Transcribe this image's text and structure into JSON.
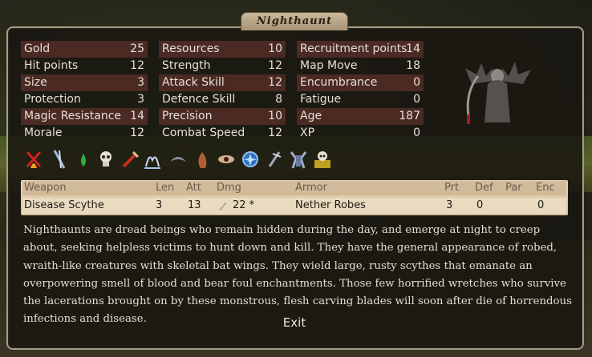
{
  "window": {
    "title": "Nighthaunt"
  },
  "stats": {
    "col1": [
      {
        "label": "Gold",
        "value": "25"
      },
      {
        "label": "Hit points",
        "value": "12"
      },
      {
        "label": "Size",
        "value": "3"
      },
      {
        "label": "Protection",
        "value": "3"
      },
      {
        "label": "Magic Resistance",
        "value": "14"
      },
      {
        "label": "Morale",
        "value": "12"
      }
    ],
    "col2": [
      {
        "label": "Resources",
        "value": "10"
      },
      {
        "label": "Strength",
        "value": "12"
      },
      {
        "label": "Attack Skill",
        "value": "12"
      },
      {
        "label": "Defence Skill",
        "value": "8"
      },
      {
        "label": "Precision",
        "value": "10"
      },
      {
        "label": "Combat Speed",
        "value": "12"
      }
    ],
    "col3": [
      {
        "label": "Recruitment points",
        "value": "14"
      },
      {
        "label": "Map Move",
        "value": "18"
      },
      {
        "label": "Encumbrance",
        "value": "0"
      },
      {
        "label": "Fatigue",
        "value": "0"
      },
      {
        "label": "Age",
        "value": "187"
      },
      {
        "label": "XP",
        "value": "0"
      }
    ]
  },
  "ability_icons": [
    "fire-resistance-icon",
    "stealth-icon",
    "poison-resistance-icon",
    "undead-icon",
    "disease-weapon-icon",
    "ethereal-icon",
    "flying-icon",
    "horror-icon",
    "darkvision-icon",
    "magic-icon",
    "cold-resistance-icon",
    "fear-icon",
    "skull-treasure-icon"
  ],
  "weapons": {
    "headers": {
      "weapon": "Weapon",
      "len": "Len",
      "att": "Att",
      "dmg": "Dmg",
      "armor": "Armor",
      "prt": "Prt",
      "def": "Def",
      "par": "Par",
      "enc": "Enc"
    },
    "row": {
      "weapon": "Disease Scythe",
      "len": "3",
      "att": "13",
      "dmg": "22 *",
      "armor": "Nether Robes",
      "prt": "3",
      "def": "0",
      "par": "",
      "enc": "0"
    }
  },
  "description": "Nighthaunts are dread beings who remain hidden during the day, and emerge at night to creep about, seeking helpless victims to hunt down and kill. They have the general appearance of robed, wraith-like creatures with skeletal bat wings. They wield large, rusty scythes that emanate an overpowering smell of blood and bear foul enchantments. Those few horrified wretches who survive the lacerations brought on by these monstrous, flesh carving blades will soon after die of horrendous infections and disease.",
  "exit_label": "Exit"
}
